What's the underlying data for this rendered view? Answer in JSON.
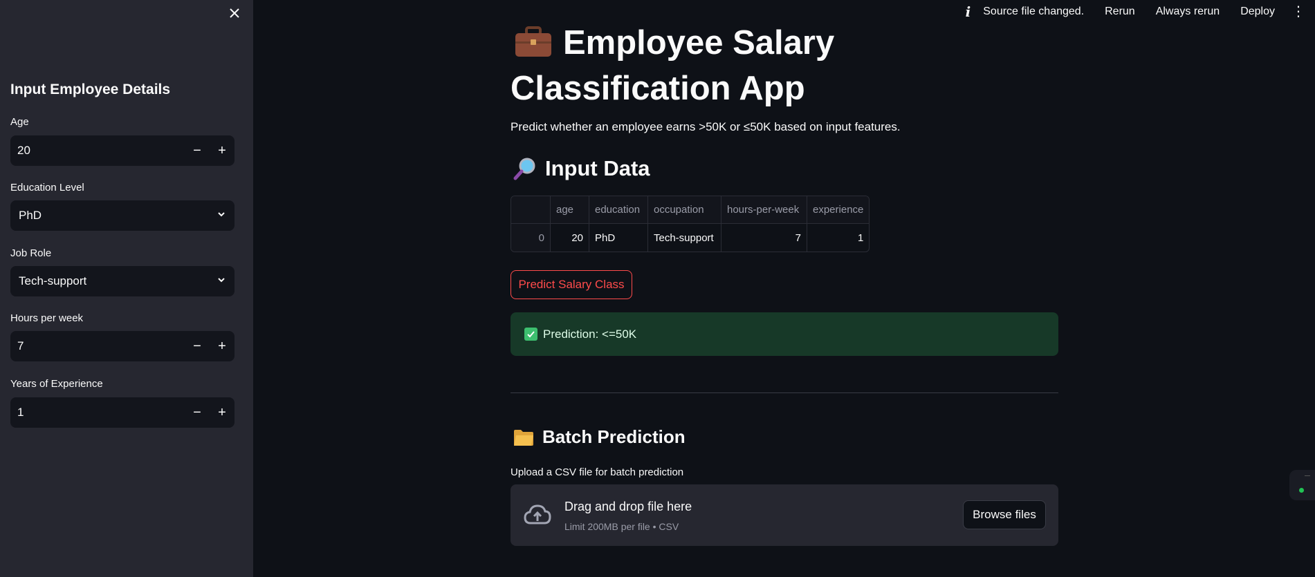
{
  "topbar": {
    "status": "Source file changed.",
    "rerun": "Rerun",
    "always_rerun": "Always rerun",
    "deploy": "Deploy"
  },
  "sidebar": {
    "title": "Input Employee Details",
    "fields": {
      "age": {
        "label": "Age",
        "value": "20"
      },
      "education": {
        "label": "Education Level",
        "value": "PhD"
      },
      "job_role": {
        "label": "Job Role",
        "value": "Tech-support"
      },
      "hours": {
        "label": "Hours per week",
        "value": "7"
      },
      "experience": {
        "label": "Years of Experience",
        "value": "1"
      }
    },
    "minus": "−",
    "plus": "+"
  },
  "main": {
    "title": "Employee Salary Classification App",
    "subtitle": "Predict whether an employee earns >50K or ≤50K based on input features.",
    "input_section": "Input Data",
    "table": {
      "headers": [
        "",
        "age",
        "education",
        "occupation",
        "hours-per-week",
        "experience"
      ],
      "rows": [
        [
          "0",
          "20",
          "PhD",
          "Tech-support",
          "7",
          "1"
        ]
      ]
    },
    "predict_button": "Predict Salary Class",
    "prediction": "Prediction: <=50K",
    "batch_section": "Batch Prediction",
    "upload_label": "Upload a CSV file for batch prediction",
    "dropzone": {
      "title": "Drag and drop file here",
      "subtitle": "Limit 200MB per file • CSV",
      "browse": "Browse files"
    }
  },
  "colors": {
    "background": "#0e1117",
    "sidebar": "#262730",
    "accent": "#ff4b4b",
    "success_bg": "#173928"
  }
}
